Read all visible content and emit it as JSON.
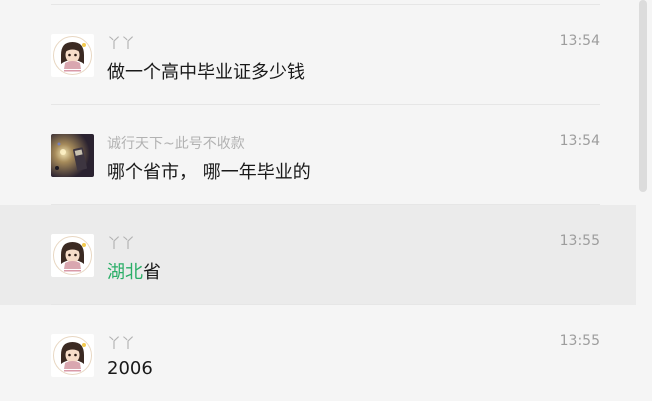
{
  "messages": [
    {
      "sender": "丫丫",
      "time": "13:54",
      "text_plain": "做一个高中毕业证多少钱",
      "avatar": "girl-avatar",
      "selected": false
    },
    {
      "sender": "诚行天下~此号不收款",
      "time": "13:54",
      "text_plain": "哪个省市， 哪一年毕业的",
      "avatar": "dark-photo-avatar",
      "selected": false
    },
    {
      "sender": "丫丫",
      "time": "13:55",
      "text_highlight": "湖北",
      "text_rest": "省",
      "avatar": "girl-avatar",
      "selected": true
    },
    {
      "sender": "丫丫",
      "time": "13:55",
      "text_plain": "2006",
      "avatar": "girl-avatar",
      "selected": false
    }
  ],
  "colors": {
    "background": "#f5f5f5",
    "selected_row": "#ebebeb",
    "highlight_text": "#2aae67",
    "sender_text": "#b2b2b2"
  }
}
